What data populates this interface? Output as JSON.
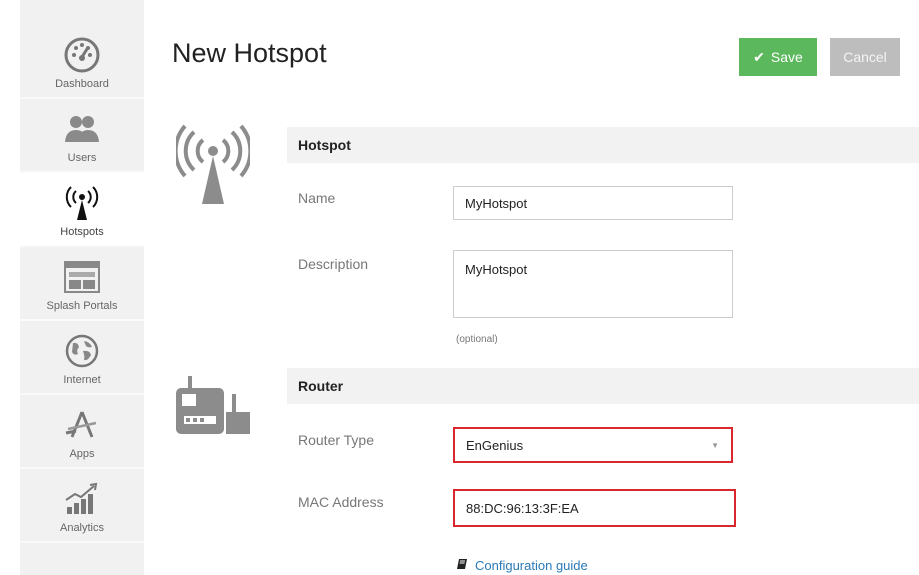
{
  "sidebar": {
    "items": [
      {
        "label": "Dashboard",
        "icon": "dashboard-icon"
      },
      {
        "label": "Users",
        "icon": "users-icon"
      },
      {
        "label": "Hotspots",
        "icon": "hotspot-icon",
        "active": true
      },
      {
        "label": "Splash Portals",
        "icon": "splash-portal-icon"
      },
      {
        "label": "Internet",
        "icon": "globe-icon"
      },
      {
        "label": "Apps",
        "icon": "apps-icon"
      },
      {
        "label": "Analytics",
        "icon": "analytics-icon"
      }
    ]
  },
  "header": {
    "title": "New Hotspot",
    "save_label": "Save",
    "cancel_label": "Cancel"
  },
  "hotspot_section": {
    "heading": "Hotspot",
    "name_label": "Name",
    "name_value": "MyHotspot",
    "description_label": "Description",
    "description_value": "MyHotspot",
    "description_help": "(optional)"
  },
  "router_section": {
    "heading": "Router",
    "router_type_label": "Router Type",
    "router_type_value": "EnGenius",
    "mac_label": "MAC Address",
    "mac_value": "88:DC:96:13:3F:EA",
    "guide_link": "Configuration guide"
  },
  "colors": {
    "save_button": "#5cb85c",
    "cancel_button": "#bdbdbd",
    "highlight_border": "#d9262f",
    "link": "#2a7ab8",
    "sidebar_bg": "#f1f1f1"
  }
}
